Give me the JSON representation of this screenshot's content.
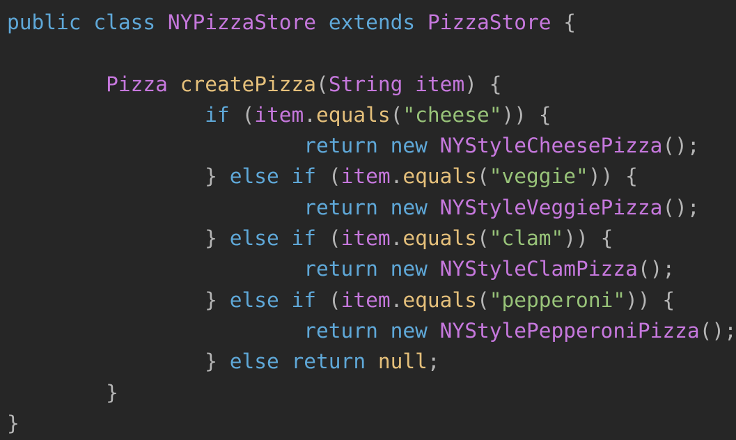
{
  "colors": {
    "background": "#262626",
    "keyword": "#5fa8d8",
    "class_name": "#c678dd",
    "method": "#e5c07b",
    "string": "#98c379",
    "punctuation": "#b5b5b5"
  },
  "code": {
    "language": "Java",
    "lines": [
      [
        {
          "t": "public",
          "k": "keyword"
        },
        {
          "t": " ",
          "k": "ws"
        },
        {
          "t": "class",
          "k": "keyword"
        },
        {
          "t": " ",
          "k": "ws"
        },
        {
          "t": "NYPizzaStore",
          "k": "class"
        },
        {
          "t": " ",
          "k": "ws"
        },
        {
          "t": "extends",
          "k": "keyword"
        },
        {
          "t": " ",
          "k": "ws"
        },
        {
          "t": "PizzaStore",
          "k": "class"
        },
        {
          "t": " ",
          "k": "ws"
        },
        {
          "t": "{",
          "k": "punct"
        }
      ],
      [],
      [
        {
          "t": "        ",
          "k": "ws"
        },
        {
          "t": "Pizza",
          "k": "type"
        },
        {
          "t": " ",
          "k": "ws"
        },
        {
          "t": "createPizza",
          "k": "method"
        },
        {
          "t": "(",
          "k": "punct"
        },
        {
          "t": "String",
          "k": "type"
        },
        {
          "t": " ",
          "k": "ws"
        },
        {
          "t": "item",
          "k": "param"
        },
        {
          "t": ")",
          "k": "punct"
        },
        {
          "t": " ",
          "k": "ws"
        },
        {
          "t": "{",
          "k": "punct"
        }
      ],
      [
        {
          "t": "                ",
          "k": "ws"
        },
        {
          "t": "if",
          "k": "keyword"
        },
        {
          "t": " ",
          "k": "ws"
        },
        {
          "t": "(",
          "k": "punct"
        },
        {
          "t": "item",
          "k": "param"
        },
        {
          "t": ".",
          "k": "punct"
        },
        {
          "t": "equals",
          "k": "method"
        },
        {
          "t": "(",
          "k": "punct"
        },
        {
          "t": "\"cheese\"",
          "k": "string"
        },
        {
          "t": "))",
          "k": "punct"
        },
        {
          "t": " ",
          "k": "ws"
        },
        {
          "t": "{",
          "k": "punct"
        }
      ],
      [
        {
          "t": "                        ",
          "k": "ws"
        },
        {
          "t": "return",
          "k": "keyword"
        },
        {
          "t": " ",
          "k": "ws"
        },
        {
          "t": "new",
          "k": "keyword"
        },
        {
          "t": " ",
          "k": "ws"
        },
        {
          "t": "NYStyleCheesePizza",
          "k": "class"
        },
        {
          "t": "();",
          "k": "punct"
        }
      ],
      [
        {
          "t": "                ",
          "k": "ws"
        },
        {
          "t": "}",
          "k": "punct"
        },
        {
          "t": " ",
          "k": "ws"
        },
        {
          "t": "else",
          "k": "keyword"
        },
        {
          "t": " ",
          "k": "ws"
        },
        {
          "t": "if",
          "k": "keyword"
        },
        {
          "t": " ",
          "k": "ws"
        },
        {
          "t": "(",
          "k": "punct"
        },
        {
          "t": "item",
          "k": "param"
        },
        {
          "t": ".",
          "k": "punct"
        },
        {
          "t": "equals",
          "k": "method"
        },
        {
          "t": "(",
          "k": "punct"
        },
        {
          "t": "\"veggie\"",
          "k": "string"
        },
        {
          "t": "))",
          "k": "punct"
        },
        {
          "t": " ",
          "k": "ws"
        },
        {
          "t": "{",
          "k": "punct"
        }
      ],
      [
        {
          "t": "                        ",
          "k": "ws"
        },
        {
          "t": "return",
          "k": "keyword"
        },
        {
          "t": " ",
          "k": "ws"
        },
        {
          "t": "new",
          "k": "keyword"
        },
        {
          "t": " ",
          "k": "ws"
        },
        {
          "t": "NYStyleVeggiePizza",
          "k": "class"
        },
        {
          "t": "();",
          "k": "punct"
        }
      ],
      [
        {
          "t": "                ",
          "k": "ws"
        },
        {
          "t": "}",
          "k": "punct"
        },
        {
          "t": " ",
          "k": "ws"
        },
        {
          "t": "else",
          "k": "keyword"
        },
        {
          "t": " ",
          "k": "ws"
        },
        {
          "t": "if",
          "k": "keyword"
        },
        {
          "t": " ",
          "k": "ws"
        },
        {
          "t": "(",
          "k": "punct"
        },
        {
          "t": "item",
          "k": "param"
        },
        {
          "t": ".",
          "k": "punct"
        },
        {
          "t": "equals",
          "k": "method"
        },
        {
          "t": "(",
          "k": "punct"
        },
        {
          "t": "\"clam\"",
          "k": "string"
        },
        {
          "t": "))",
          "k": "punct"
        },
        {
          "t": " ",
          "k": "ws"
        },
        {
          "t": "{",
          "k": "punct"
        }
      ],
      [
        {
          "t": "                        ",
          "k": "ws"
        },
        {
          "t": "return",
          "k": "keyword"
        },
        {
          "t": " ",
          "k": "ws"
        },
        {
          "t": "new",
          "k": "keyword"
        },
        {
          "t": " ",
          "k": "ws"
        },
        {
          "t": "NYStyleClamPizza",
          "k": "class"
        },
        {
          "t": "();",
          "k": "punct"
        }
      ],
      [
        {
          "t": "                ",
          "k": "ws"
        },
        {
          "t": "}",
          "k": "punct"
        },
        {
          "t": " ",
          "k": "ws"
        },
        {
          "t": "else",
          "k": "keyword"
        },
        {
          "t": " ",
          "k": "ws"
        },
        {
          "t": "if",
          "k": "keyword"
        },
        {
          "t": " ",
          "k": "ws"
        },
        {
          "t": "(",
          "k": "punct"
        },
        {
          "t": "item",
          "k": "param"
        },
        {
          "t": ".",
          "k": "punct"
        },
        {
          "t": "equals",
          "k": "method"
        },
        {
          "t": "(",
          "k": "punct"
        },
        {
          "t": "\"pepperoni\"",
          "k": "string"
        },
        {
          "t": "))",
          "k": "punct"
        },
        {
          "t": " ",
          "k": "ws"
        },
        {
          "t": "{",
          "k": "punct"
        }
      ],
      [
        {
          "t": "                        ",
          "k": "ws"
        },
        {
          "t": "return",
          "k": "keyword"
        },
        {
          "t": " ",
          "k": "ws"
        },
        {
          "t": "new",
          "k": "keyword"
        },
        {
          "t": " ",
          "k": "ws"
        },
        {
          "t": "NYStylePepperoniPizza",
          "k": "class"
        },
        {
          "t": "();",
          "k": "punct"
        }
      ],
      [
        {
          "t": "                ",
          "k": "ws"
        },
        {
          "t": "}",
          "k": "punct"
        },
        {
          "t": " ",
          "k": "ws"
        },
        {
          "t": "else",
          "k": "keyword"
        },
        {
          "t": " ",
          "k": "ws"
        },
        {
          "t": "return",
          "k": "keyword"
        },
        {
          "t": " ",
          "k": "ws"
        },
        {
          "t": "null",
          "k": "method"
        },
        {
          "t": ";",
          "k": "punct"
        }
      ],
      [
        {
          "t": "        ",
          "k": "ws"
        },
        {
          "t": "}",
          "k": "punct"
        }
      ],
      [
        {
          "t": "}",
          "k": "punct"
        }
      ]
    ]
  }
}
